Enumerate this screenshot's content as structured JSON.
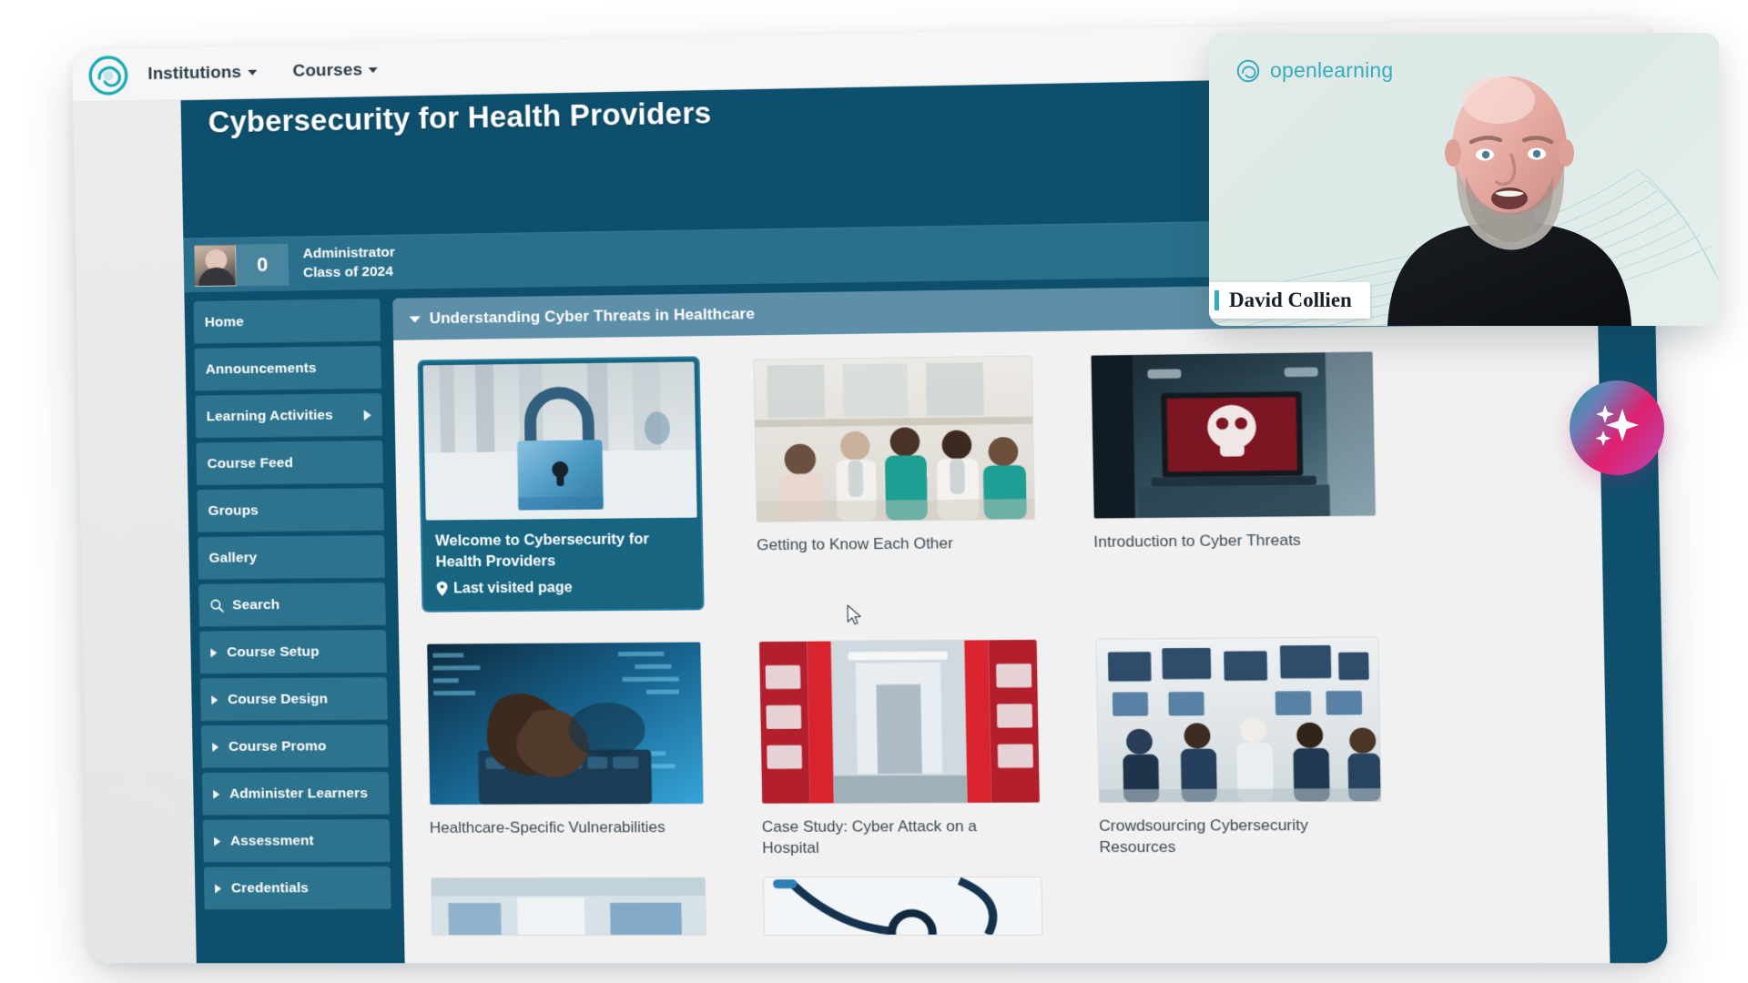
{
  "topbar": {
    "logo_icon": "openlearning-logo-icon",
    "nav": [
      {
        "label": "Institutions",
        "icon": "chevron-down-icon"
      },
      {
        "label": "Courses",
        "icon": "chevron-down-icon"
      }
    ]
  },
  "course": {
    "title": "Cybersecurity for Health Providers",
    "user": {
      "points": "0",
      "role": "Administrator",
      "class": "Class of 2024",
      "avatar_icon": "avatar"
    }
  },
  "sidebar": {
    "items": [
      {
        "label": "Home",
        "icon": null,
        "expandable": false,
        "arrow": false
      },
      {
        "label": "Announcements",
        "icon": null,
        "expandable": false,
        "arrow": false
      },
      {
        "label": "Learning Activities",
        "icon": null,
        "expandable": false,
        "arrow": true
      },
      {
        "label": "Course Feed",
        "icon": null,
        "expandable": false,
        "arrow": false
      },
      {
        "label": "Groups",
        "icon": null,
        "expandable": false,
        "arrow": false
      },
      {
        "label": "Gallery",
        "icon": null,
        "expandable": false,
        "arrow": false
      },
      {
        "label": "Search",
        "icon": "search-icon",
        "expandable": false,
        "arrow": false
      },
      {
        "label": "Course Setup",
        "icon": "chevron-right-icon",
        "expandable": true,
        "arrow": false
      },
      {
        "label": "Course Design",
        "icon": "chevron-right-icon",
        "expandable": true,
        "arrow": false
      },
      {
        "label": "Course Promo",
        "icon": "chevron-right-icon",
        "expandable": true,
        "arrow": false
      },
      {
        "label": "Administer Learners",
        "icon": "chevron-right-icon",
        "expandable": true,
        "arrow": false
      },
      {
        "label": "Assessment",
        "icon": "chevron-right-icon",
        "expandable": true,
        "arrow": false
      },
      {
        "label": "Credentials",
        "icon": "chevron-right-icon",
        "expandable": true,
        "arrow": false
      }
    ]
  },
  "section": {
    "title": "Understanding Cyber Threats in Healthcare",
    "toggle_icon": "chevron-down-icon"
  },
  "cards": [
    {
      "title": "Welcome to Cybersecurity for Health Providers",
      "badge": "Last visited page",
      "badge_icon": "location-pin-icon",
      "active": true,
      "thumb": "padlock-photo"
    },
    {
      "title": "Getting to Know Each Other",
      "badge": null,
      "active": false,
      "thumb": "healthcare-workers-group-photo"
    },
    {
      "title": "Introduction to Cyber Threats",
      "badge": null,
      "active": false,
      "thumb": "hospital-corridor-skull-screen-photo"
    },
    {
      "title": "Healthcare-Specific Vulnerabilities",
      "badge": null,
      "active": false,
      "thumb": "hands-keyboard-data-photo"
    },
    {
      "title": "Case Study: Cyber Attack on a Hospital",
      "badge": null,
      "active": false,
      "thumb": "red-alert-hospital-corridor-photo"
    },
    {
      "title": "Crowdsourcing Cybersecurity Resources",
      "badge": null,
      "active": false,
      "thumb": "security-operations-room-photo"
    }
  ],
  "cards_bottom": [
    {
      "title": "",
      "thumb": "hospital-room-photo"
    },
    {
      "title": "",
      "thumb": "stethoscope-photo"
    },
    {
      "title": "",
      "thumb": ""
    }
  ],
  "video": {
    "logo_text": "openlearning",
    "logo_icon": "openlearning-logo-icon",
    "speaker_name": "David Collien"
  },
  "ai_button": {
    "icon": "sparkle-icon",
    "gradient_from": "#16a39b",
    "gradient_mid": "#e01f6e",
    "gradient_to": "#b44bb4"
  },
  "colors": {
    "course_dark": "#0d4f6c",
    "course_mid": "#2a708c",
    "sidebar_item": "#2e738e",
    "section_header": "#5d8fa8",
    "active_card": "#186582",
    "brand_teal": "#3aaabf"
  },
  "cursor": {
    "icon": "mouse-pointer-icon"
  }
}
